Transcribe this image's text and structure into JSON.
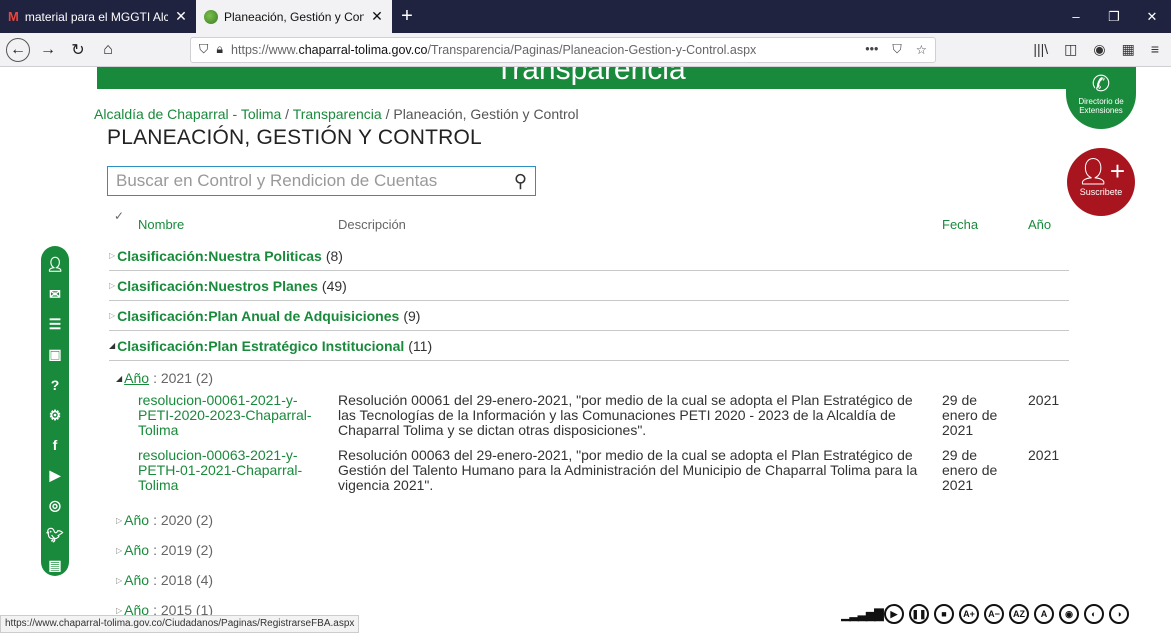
{
  "browser": {
    "tabs": [
      {
        "title": "material para el MGGTI Alcaldía",
        "active": false
      },
      {
        "title": "Planeación, Gestión y Control",
        "active": true
      }
    ],
    "new_tab": "+",
    "url_prefix": "https://www.",
    "url_domain": "chaparral-tolima.gov.co",
    "url_path": "/Transparencia/Paginas/Planeacion-Gestion-y-Control.aspx",
    "status_url": "https://www.chaparral-tolima.gov.co/Ciudadanos/Paginas/RegistrarseFBA.aspx"
  },
  "banner": {
    "title": "Transparencia"
  },
  "breadcrumb": {
    "home": "Alcaldía de Chaparral - Tolima",
    "sep": " / ",
    "section": "Transparencia",
    "current": "Planeación, Gestión y Control"
  },
  "page_title": "PLANEACIÓN, GESTIÓN Y CONTROL",
  "search": {
    "placeholder": "Buscar en Control y Rendicion de Cuentas"
  },
  "columns": {
    "check": "✓",
    "name": "Nombre",
    "description": "Descripción",
    "date": "Fecha",
    "year": "Año"
  },
  "groups": [
    {
      "key": "Clasificación",
      "sep": " : ",
      "value": "Nuestra Politicas",
      "count": "(8)",
      "expanded": false
    },
    {
      "key": "Clasificación",
      "sep": " : ",
      "value": "Nuestros Planes",
      "count": "(49)",
      "expanded": false
    },
    {
      "key": "Clasificación",
      "sep": " : ",
      "value": "Plan Anual de Adquisiciones",
      "count": "(9)",
      "expanded": false
    },
    {
      "key": "Clasificación",
      "sep": " : ",
      "value": "Plan Estratégico Institucional",
      "count": "(11)",
      "expanded": true
    }
  ],
  "subgroups": [
    {
      "label": "Año",
      "year": ": 2021",
      "count": "(2)",
      "expanded": true
    },
    {
      "label": "Año",
      "year": ": 2020",
      "count": "(2)",
      "expanded": false
    },
    {
      "label": "Año",
      "year": ": 2019",
      "count": "(2)",
      "expanded": false
    },
    {
      "label": "Año",
      "year": ": 2018",
      "count": "(4)",
      "expanded": false
    },
    {
      "label": "Año",
      "year": ": 2015",
      "count": "(1)",
      "expanded": false
    }
  ],
  "rows": [
    {
      "name": "resolucion-00061-2021-y-PETI-2020-2023-Chaparral-Tolima",
      "description": "Resolución 00061 del 29-enero-2021, \"por medio de la cual se adopta el Plan Estratégico de las Tecnologías de la Información y las Comunaciones PETI 2020 - 2023 de la Alcaldía de Chaparral Tolima y se dictan otras disposiciones\".",
      "date": "29 de enero de 2021",
      "year": "2021"
    },
    {
      "name": "resolucion-00063-2021-y-PETH-01-2021-Chaparral-Tolima",
      "description": "Resolución 00063 del 29-enero-2021, \"por medio de la cual se adopta el Plan Estratégico de Gestión del Talento Humano para la Administración del Municipio de Chaparral Tolima para la vigencia 2021\".",
      "date": "29 de enero de 2021",
      "year": "2021"
    }
  ],
  "floating": {
    "directory": "Directorio de Extensiones",
    "subscribe": "Suscribete"
  },
  "accessibility": {
    "contrast": "A+",
    "decrease": "A−",
    "reset": "AZ",
    "a": "A"
  },
  "colors": {
    "brand_green": "#198a3b",
    "subscribe_red": "#a8151e",
    "tabbar": "#202340"
  }
}
